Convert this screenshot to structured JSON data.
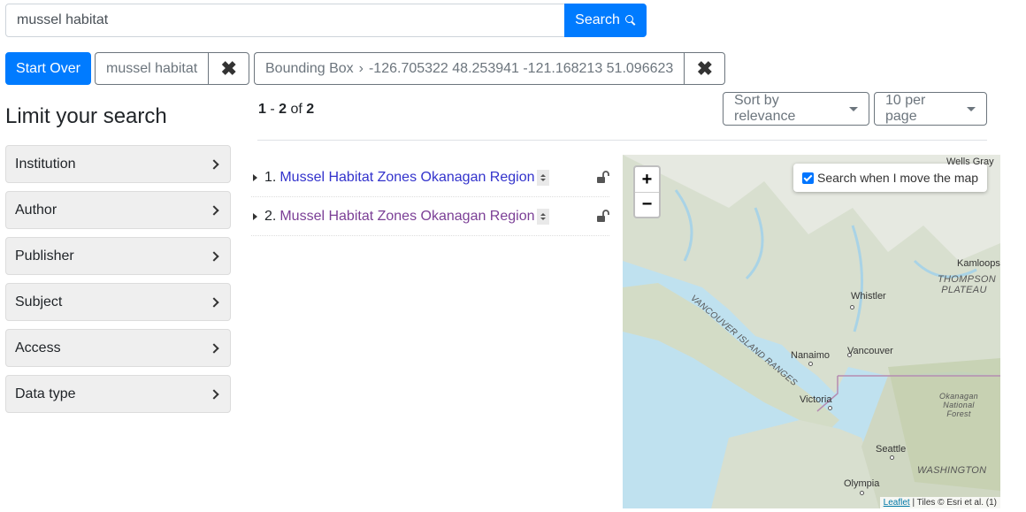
{
  "search": {
    "query": "mussel habitat",
    "button_label": "Search"
  },
  "constraints": {
    "start_over": "Start Over",
    "query_chip": "mussel habitat",
    "bbox_label": "Bounding Box",
    "bbox_separator": "›",
    "bbox_value": "-126.705322 48.253941 -121.168213 51.096623",
    "remove_glyph": "✖"
  },
  "sidebar": {
    "title": "Limit your search",
    "facets": [
      "Institution",
      "Author",
      "Publisher",
      "Subject",
      "Access",
      "Data type"
    ]
  },
  "results": {
    "range_start": "1",
    "range_sep": " - ",
    "range_end": "2",
    "of": " of ",
    "total": "2",
    "sort_label": "Sort by relevance",
    "per_page_label": "10 per page",
    "docs": [
      {
        "index": "1.",
        "title": "Mussel Habitat Zones Okanagan Region",
        "color": "#3333cc"
      },
      {
        "index": "2.",
        "title": "Mussel Habitat Zones Okanagan Region",
        "color": "#7b3f96"
      }
    ]
  },
  "map": {
    "zoom_in": "+",
    "zoom_out": "−",
    "search_when_move": "Search when I move the map",
    "places": [
      "Whistler",
      "Vancouver",
      "Nanaimo",
      "Victoria",
      "Seattle",
      "Olympia",
      "Kamloops",
      "Wells Gray"
    ],
    "regions": [
      "THOMPSON PLATEAU",
      "VANCOUVER ISLAND RANGES",
      "WASHINGTON",
      "Okanagan National Forest"
    ],
    "attribution_link": "Leaflet",
    "attribution_text": " | Tiles © Esri et al. (1)"
  }
}
